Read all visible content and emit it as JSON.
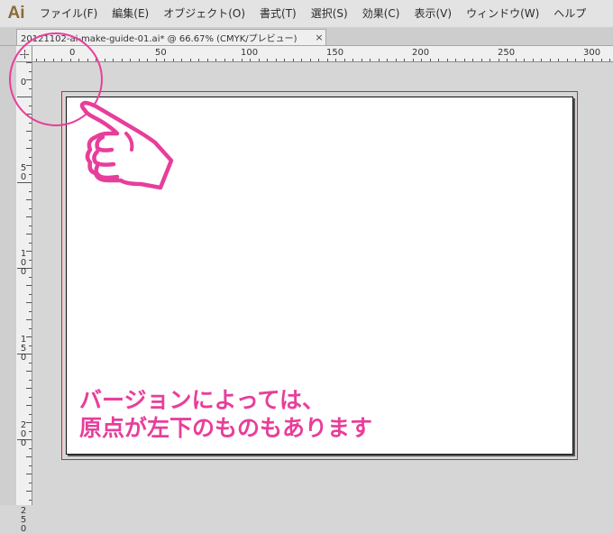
{
  "app": {
    "logo_text": "Ai"
  },
  "menu": [
    {
      "id": "file",
      "label": "ファイル(F)"
    },
    {
      "id": "edit",
      "label": "編集(E)"
    },
    {
      "id": "object",
      "label": "オブジェクト(O)"
    },
    {
      "id": "type",
      "label": "書式(T)"
    },
    {
      "id": "select",
      "label": "選択(S)"
    },
    {
      "id": "effect",
      "label": "効果(C)"
    },
    {
      "id": "view",
      "label": "表示(V)"
    },
    {
      "id": "window",
      "label": "ウィンドウ(W)"
    },
    {
      "id": "help",
      "label": "ヘルプ"
    }
  ],
  "document_tab": {
    "title": "20121102-ai-make-guide-01.ai* @ 66.67% (CMYK/プレビュー)",
    "close_symbol": "×"
  },
  "rulers": {
    "horizontal_labels": [
      "0",
      "50",
      "100",
      "150",
      "200",
      "250",
      "300"
    ],
    "vertical_labels": [
      "0",
      "50",
      "100",
      "150",
      "200",
      "250"
    ]
  },
  "annotation": {
    "line1": "バージョンによっては、",
    "line2": "原点が左下のものもあります",
    "color": "#e83e9b"
  },
  "colors": {
    "bleed": "#e81e2a",
    "accent": "#e83e9b"
  }
}
